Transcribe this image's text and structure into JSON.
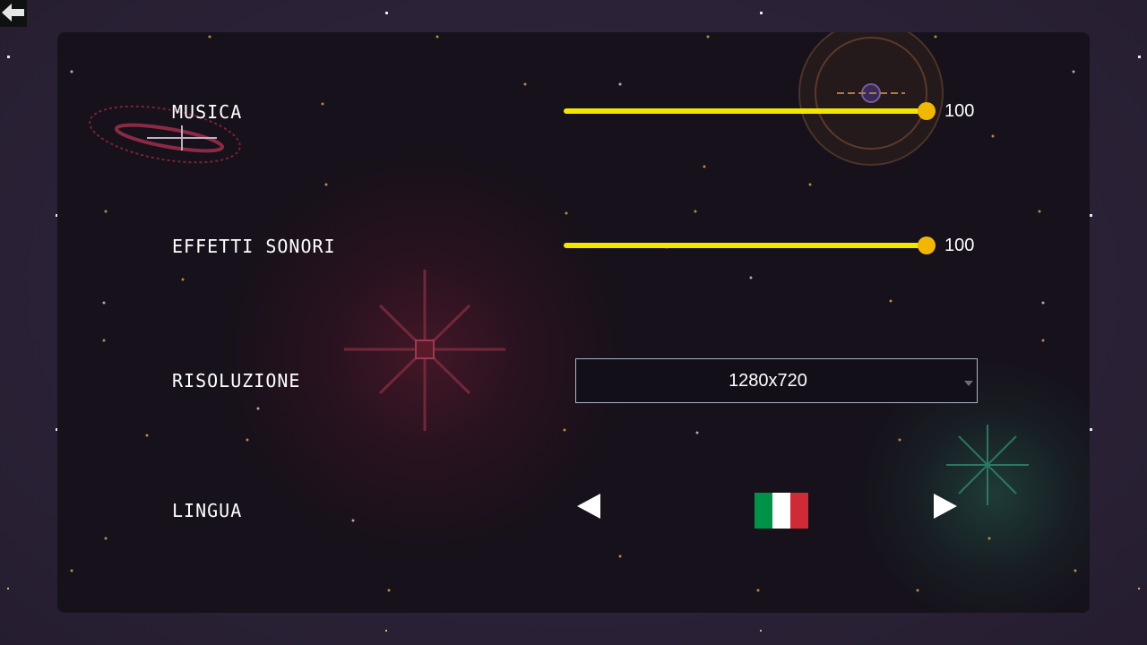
{
  "settings": {
    "music": {
      "label": "MUSICA",
      "value": "100",
      "level": 1.0
    },
    "sfx": {
      "label": "EFFETTI SONORI",
      "value": "100",
      "level": 1.0
    },
    "resolution": {
      "label": "RISOLUZIONE",
      "value": "1280x720"
    },
    "language": {
      "label": "LINGUA",
      "flag": "italy-flag"
    }
  },
  "colors": {
    "slider_fill": "#f2e600",
    "slider_knob": "#f2b705",
    "flag_green": "#009246",
    "flag_white": "#ffffff",
    "flag_red": "#ce2b37"
  },
  "icons": {
    "back": "arrow-left-icon",
    "prev_language": "triangle-left-icon",
    "next_language": "triangle-right-icon",
    "dropdown": "chevron-down-icon"
  }
}
